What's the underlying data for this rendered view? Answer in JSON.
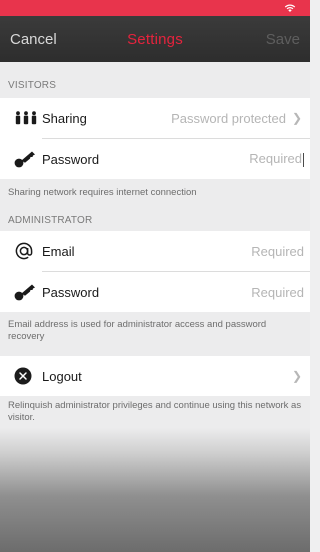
{
  "nav": {
    "cancel_label": "Cancel",
    "title": "Settings",
    "save_label": "Save"
  },
  "visitors": {
    "header": "VISITORS",
    "sharing": {
      "label": "Sharing",
      "value": "Password protected"
    },
    "password": {
      "label": "Password",
      "placeholder": "Required"
    },
    "footnote": "Sharing network requires internet connection"
  },
  "administrator": {
    "header": "ADMINISTRATOR",
    "email": {
      "label": "Email",
      "placeholder": "Required"
    },
    "password": {
      "label": "Password",
      "placeholder": "Required"
    },
    "footnote": "Email address is used for administrator access and password recovery"
  },
  "logout": {
    "label": "Logout",
    "footnote": "Relinquish administrator privileges and continue using this network as visitor."
  },
  "colors": {
    "accent": "#e5233d",
    "status_bar": "#e8344c",
    "nav_bg": "#333333"
  }
}
